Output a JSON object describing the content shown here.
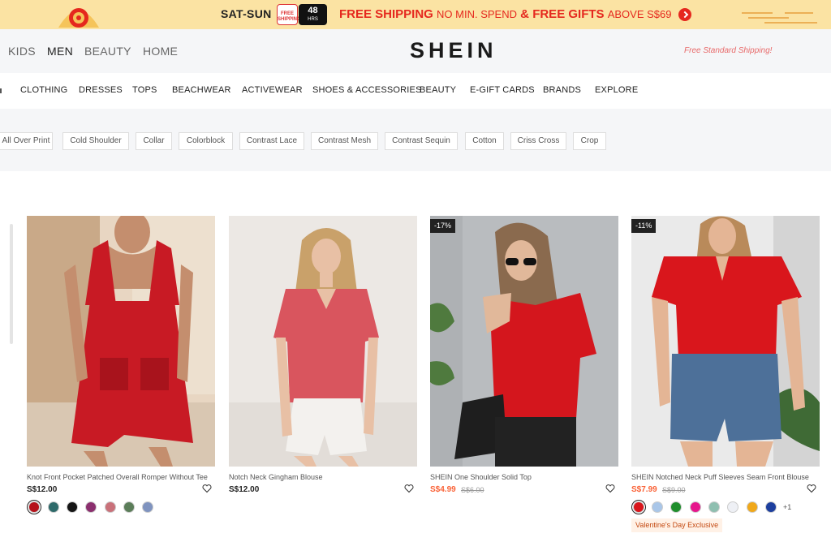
{
  "promo": {
    "days": "SAT-SUN",
    "badge_free": "FREE SHIPPING",
    "badge_hours_num": "48",
    "badge_hours_unit": "HRS",
    "free_shipping": "FREE SHIPPING",
    "no_min": "NO MIN. SPEND",
    "amp": "&",
    "free_gifts": "FREE GIFTS",
    "above": "ABOVE S$69",
    "colors": {
      "bg": "#fbe3a3",
      "accent": "#e5281e"
    }
  },
  "header": {
    "categories": [
      "KIDS",
      "MEN",
      "BEAUTY",
      "HOME"
    ],
    "active_category": "MEN",
    "logo": "SHEIN",
    "free_shipping_note": "Free Standard Shipping!"
  },
  "nav": {
    "items": [
      "CLOTHING",
      "DRESSES",
      "TOPS",
      "BEACHWEAR",
      "ACTIVEWEAR",
      "SHOES & ACCESSORIES",
      "BEAUTY",
      "E-GIFT CARDS",
      "BRANDS",
      "EXPLORE"
    ]
  },
  "filters": {
    "chips": [
      "All Over Print",
      "Cold Shoulder",
      "Collar",
      "Colorblock",
      "Contrast Lace",
      "Contrast Mesh",
      "Contrast Sequin",
      "Cotton",
      "Criss Cross",
      "Crop"
    ]
  },
  "products": [
    {
      "title": "Knot Front Pocket Patched Overall Romper Without Tee",
      "price": "S$12.00",
      "old_price": "",
      "discount": "",
      "swatches": [
        "#b5121b",
        "#2e6a6a",
        "#151515",
        "#8b2f6e",
        "#c9717a",
        "#5b7d59",
        "#7f93bf"
      ],
      "more": "",
      "tag": ""
    },
    {
      "title": "Notch Neck Gingham Blouse",
      "price": "S$12.00",
      "old_price": "",
      "discount": "",
      "swatches": [],
      "more": "",
      "tag": ""
    },
    {
      "title": "SHEIN One Shoulder Solid Top",
      "price": "S$4.99",
      "old_price": "S$6.00",
      "discount": "-17%",
      "swatches": [],
      "more": "",
      "tag": ""
    },
    {
      "title": "SHEIN Notched Neck Puff Sleeves Seam Front Blouse",
      "price": "S$7.99",
      "old_price": "S$9.00",
      "discount": "-11%",
      "swatches": [
        "#d9161c",
        "#a9c6e8",
        "#1f8e2c",
        "#e6168c",
        "#8fbfb0",
        "#eef0f5",
        "#f0a81a",
        "#1d3f9e"
      ],
      "more": "+1",
      "tag": "Valentine's Day Exclusive"
    }
  ]
}
